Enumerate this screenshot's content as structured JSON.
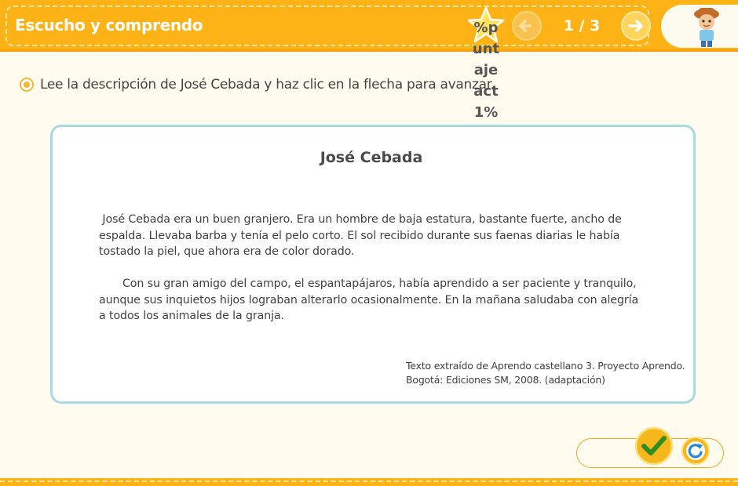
{
  "header": {
    "title": "Escucho y comprendo",
    "score_text": "%puntajeact1%",
    "page_indicator": "1 / 3",
    "prev_icon": "arrow-left-icon",
    "next_icon": "arrow-right-icon",
    "star_icon": "star-icon",
    "avatar_icon": "boy-avatar-icon",
    "colors": {
      "bar": "#fdb316",
      "accent": "#f8b531"
    }
  },
  "instruction": {
    "text": "Lee la descripción de José Cebada y haz clic en la flecha para avanzar."
  },
  "reading": {
    "title": "José Cebada",
    "paragraphs": [
      " José Cebada era un buen granjero. Era un hombre de baja estatura, bastante fuerte, ancho de espalda. Llevaba barba y tenía el pelo corto. El sol recibido durante sus faenas diarias le había tostado la piel, que ahora era de color dorado.",
      "Con su gran amigo del campo, el espantapájaros, había aprendido a ser paciente y tranquilo, aunque sus inquietos hijos lograban alterarlo ocasionalmente. En la mañana saludaba con alegría a todos los animales de la granja."
    ],
    "source_line1": "Texto extraído de Aprendo castellano 3. Proyecto Aprendo.",
    "source_line2": "Bogotá: Ediciones SM, 2008. (adaptación)",
    "border_color": "#a9d9e2"
  },
  "footer": {
    "check_icon": "checkmark-icon",
    "reset_icon": "reset-icon"
  }
}
